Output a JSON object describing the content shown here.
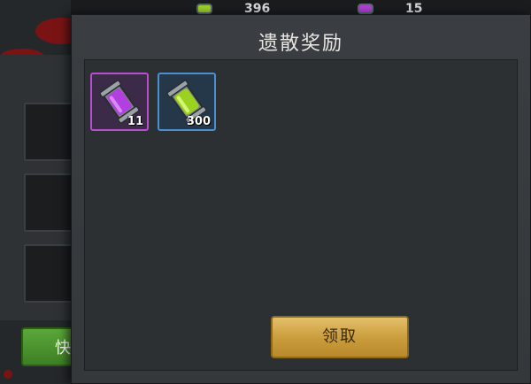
{
  "topbar": {
    "resources": [
      {
        "icon": "green-vial-icon",
        "value": "396"
      },
      {
        "icon": "purple-vial-icon",
        "value": "15"
      }
    ]
  },
  "background": {
    "quick_button_label": "快"
  },
  "dialog": {
    "title": "遗散奖励",
    "rewards": [
      {
        "icon": "purple-vial-icon",
        "rarity_color": "#b74fcf",
        "count": "11"
      },
      {
        "icon": "green-vial-icon",
        "rarity_color": "#4c8fd1",
        "count": "300"
      }
    ],
    "claim_label": "领取"
  }
}
